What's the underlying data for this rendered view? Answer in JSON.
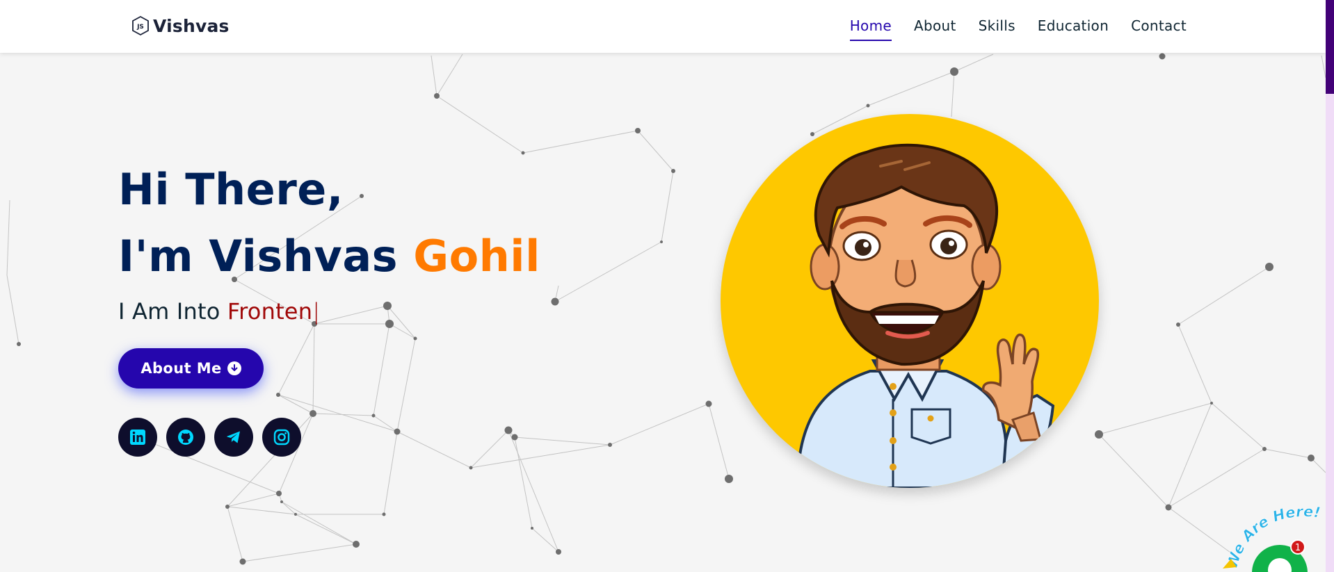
{
  "colors": {
    "brand_dark": "#002057",
    "accent_orange": "#ff7a00",
    "typed_red": "#a00808",
    "primary_button": "#2506ad",
    "avatar_bg": "#fec800",
    "social_bg": "#0e0e2c",
    "social_icon": "#00d8ff",
    "page_bg": "#f5f5f5"
  },
  "navbar": {
    "brand_icon": "nodejs-hexagon-icon",
    "brand_name": "Vishvas",
    "links": [
      {
        "label": "Home",
        "active": true
      },
      {
        "label": "About",
        "active": false
      },
      {
        "label": "Skills",
        "active": false
      },
      {
        "label": "Education",
        "active": false
      },
      {
        "label": "Contact",
        "active": false
      }
    ]
  },
  "hero": {
    "greeting_line1": "Hi There,",
    "greeting_line2_prefix": "I'm Vishvas",
    "greeting_line2_accent": "Gohil",
    "typed_prefix": "I Am Into",
    "typed_text": "Fronten",
    "typed_caret": "|",
    "about_button_label": "About Me",
    "about_button_icon": "arrow-circle-down-icon",
    "socials": [
      {
        "name": "linkedin-icon"
      },
      {
        "name": "github-icon"
      },
      {
        "name": "telegram-icon"
      },
      {
        "name": "instagram-icon"
      }
    ]
  },
  "chat_widget": {
    "label": "We Are Here!",
    "badge_count": "1",
    "icon": "chat-bubble-icon"
  }
}
